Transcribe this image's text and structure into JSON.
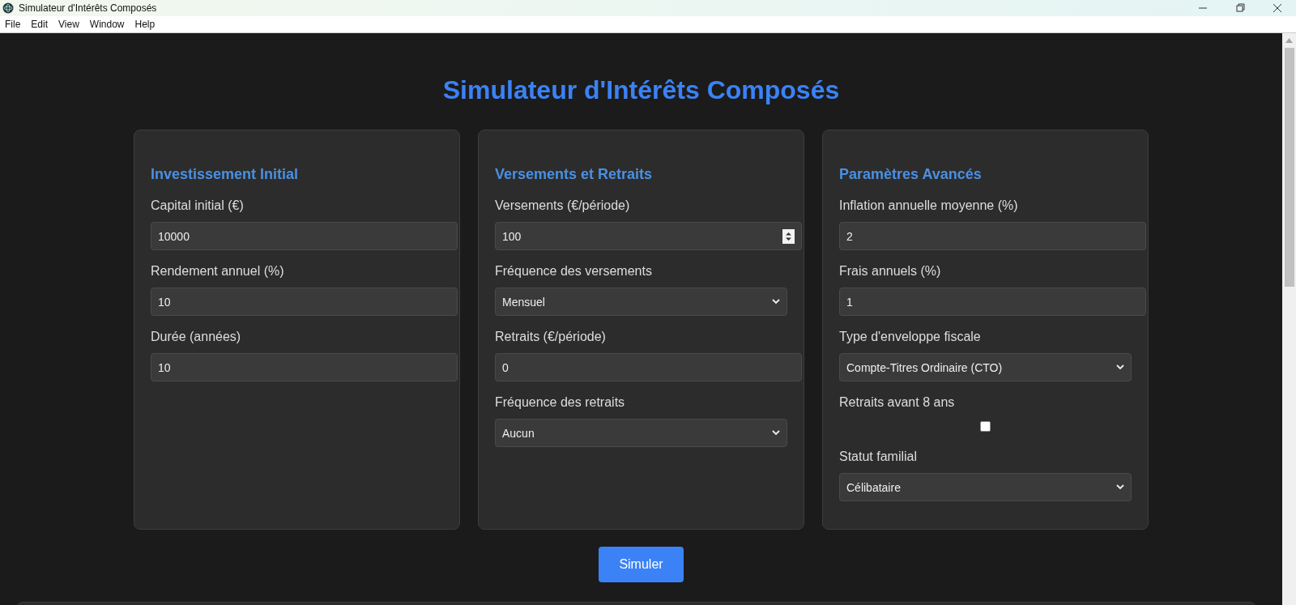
{
  "window": {
    "title": "Simulateur d'Intérêts Composés"
  },
  "menu": [
    "File",
    "Edit",
    "View",
    "Window",
    "Help"
  ],
  "page_title": "Simulateur d'Intérêts Composés",
  "sections": [
    {
      "title": "Investissement Initial",
      "fields": [
        {
          "kind": "number",
          "label": "Capital initial (€)",
          "value": "10000",
          "spinner": false
        },
        {
          "kind": "number",
          "label": "Rendement annuel (%)",
          "value": "10",
          "spinner": false
        },
        {
          "kind": "number",
          "label": "Durée (années)",
          "value": "10",
          "spinner": false
        }
      ]
    },
    {
      "title": "Versements et Retraits",
      "fields": [
        {
          "kind": "number",
          "label": "Versements (€/période)",
          "value": "100",
          "spinner": true
        },
        {
          "kind": "select",
          "label": "Fréquence des versements",
          "value": "Mensuel"
        },
        {
          "kind": "number",
          "label": "Retraits (€/période)",
          "value": "0",
          "spinner": false
        },
        {
          "kind": "select",
          "label": "Fréquence des retraits",
          "value": "Aucun"
        }
      ]
    },
    {
      "title": "Paramètres Avancés",
      "fields": [
        {
          "kind": "number",
          "label": "Inflation annuelle moyenne (%)",
          "value": "2",
          "spinner": false
        },
        {
          "kind": "number",
          "label": "Frais annuels (%)",
          "value": "1",
          "spinner": false
        },
        {
          "kind": "select",
          "label": "Type d'enveloppe fiscale",
          "value": "Compte-Titres Ordinaire (CTO)"
        },
        {
          "kind": "checkbox",
          "label": "Retraits avant 8 ans",
          "checked": false
        },
        {
          "kind": "select",
          "label": "Statut familial",
          "value": "Célibataire"
        }
      ]
    }
  ],
  "simulate_button": "Simuler"
}
